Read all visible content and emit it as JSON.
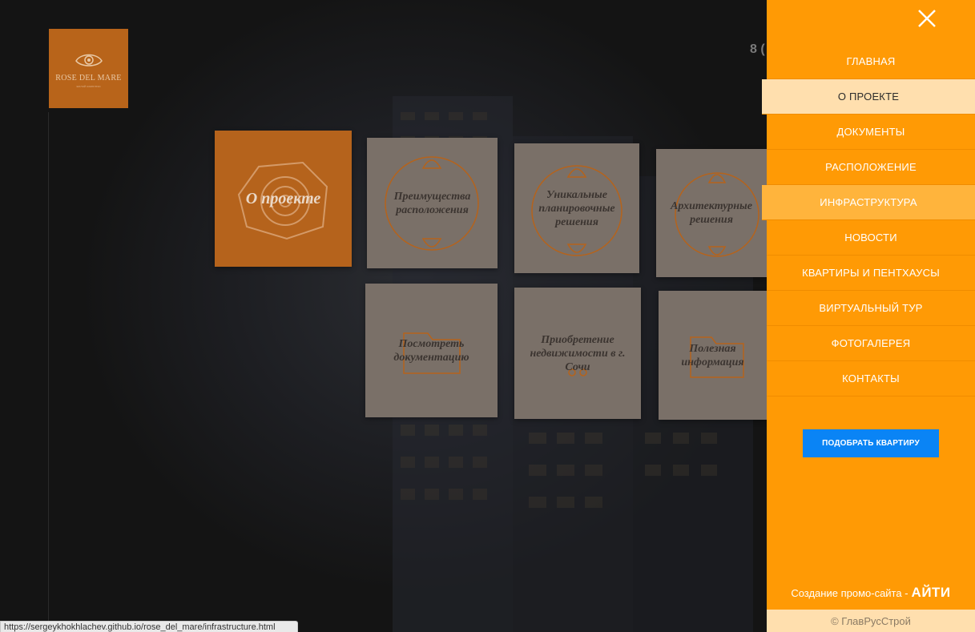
{
  "logo": {
    "name": "ROSE DEL MARE",
    "tagline": "жилой комплекс"
  },
  "header": {
    "phone_partial": "8 ("
  },
  "tiles": [
    {
      "label": "О проекте"
    },
    {
      "label": "Преимущества расположения"
    },
    {
      "label": "Уникальные планировочные решения"
    },
    {
      "label": "Архитектурные решения"
    },
    {
      "label": "Посмотреть документацию"
    },
    {
      "label": "Приобретение недвижимости в г. Сочи"
    },
    {
      "label": "Полезная информация"
    }
  ],
  "sidebar": {
    "close_icon": "close-icon",
    "menu": [
      {
        "label": "ГЛАВНАЯ"
      },
      {
        "label": "О ПРОЕКТЕ",
        "state": "active"
      },
      {
        "label": "ДОКУМЕНТЫ"
      },
      {
        "label": "РАСПОЛОЖЕНИЕ"
      },
      {
        "label": "ИНФРАСТРУКТУРА",
        "state": "hover"
      },
      {
        "label": "НОВОСТИ"
      },
      {
        "label": "КВАРТИРЫ И ПЕНТХАУСЫ"
      },
      {
        "label": "ВИРТУАЛЬНЫЙ ТУР"
      },
      {
        "label": "ФОТОГАЛЕРЕЯ"
      },
      {
        "label": "КОНТАКТЫ"
      }
    ],
    "cta_label": "ПОДОБРАТЬ КВАРТИРУ",
    "credit_text": "Создание промо-сайта -",
    "credit_brand": "АЙТИ",
    "copyright": "© ГлавРусСтрой"
  },
  "status_bar": {
    "url": "https://sergeykhokhlachev.github.io/rose_del_mare/infrastructure.html"
  },
  "colors": {
    "accent": "#ff9a05",
    "active_item_bg": "#ffdfae",
    "cta_blue": "#0a84f5",
    "tile_main": "#b5631c",
    "tile": "#7a7068"
  }
}
